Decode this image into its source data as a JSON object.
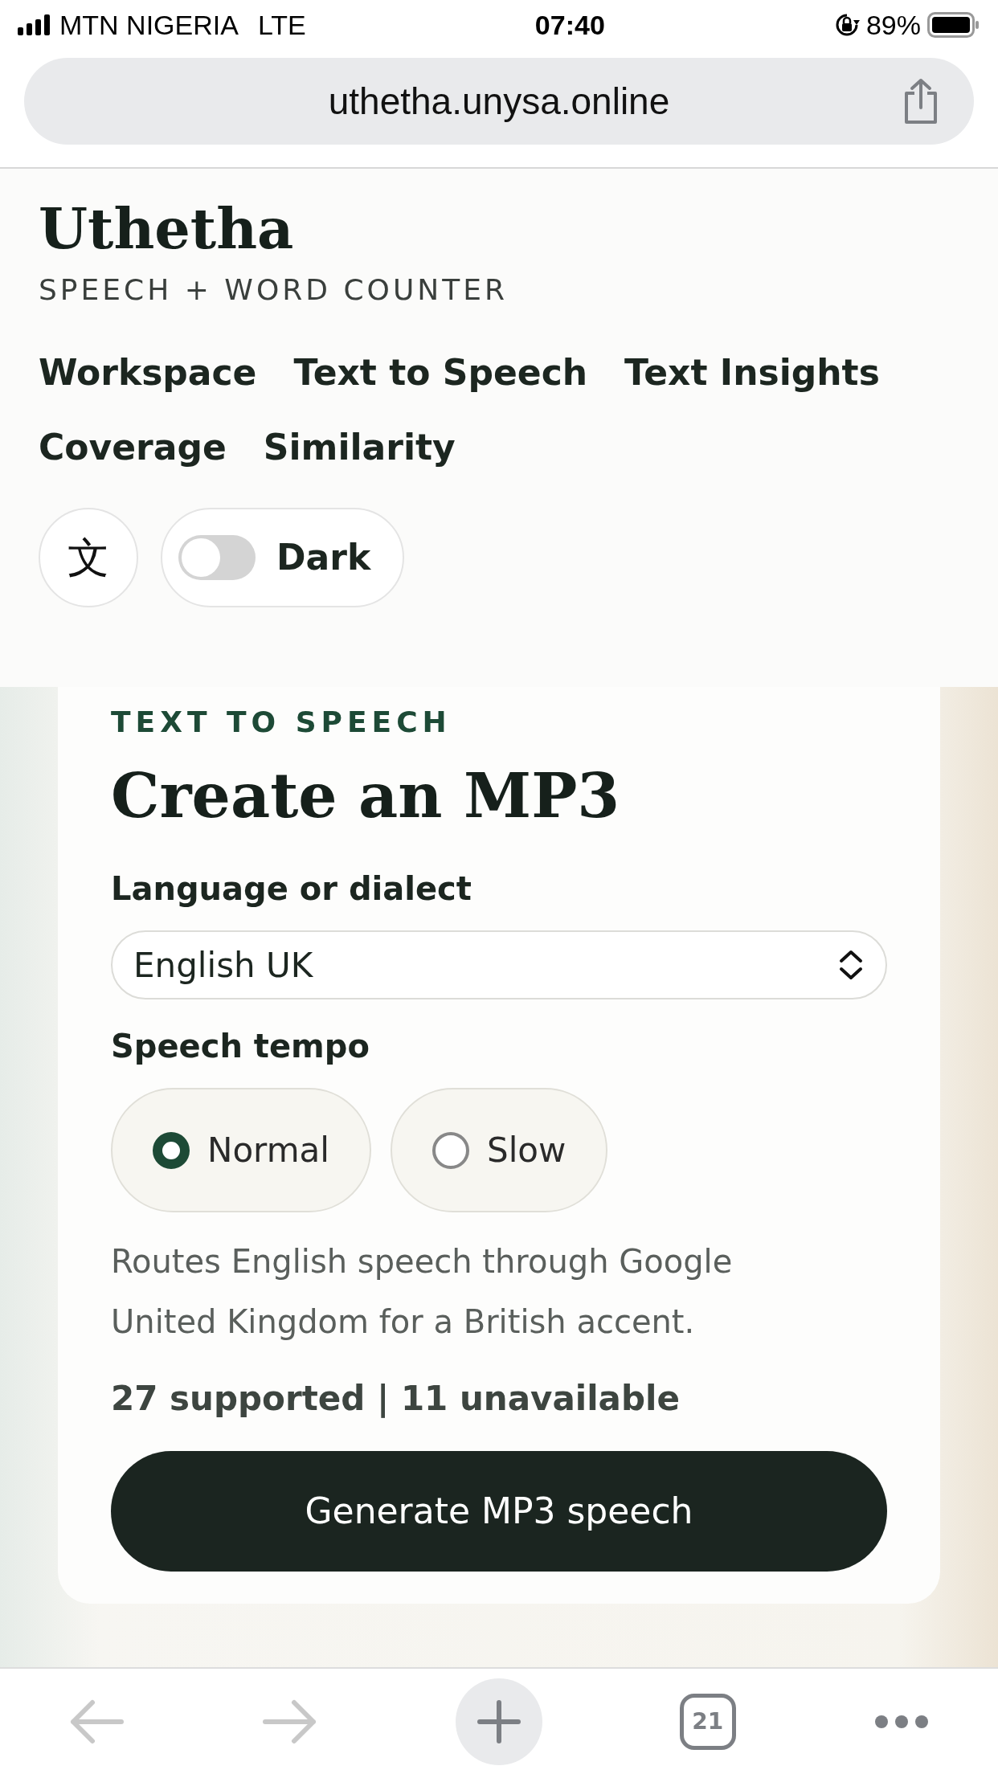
{
  "status_bar": {
    "carrier": "MTN NIGERIA",
    "network": "LTE",
    "time": "07:40",
    "battery": "89%"
  },
  "address_bar": {
    "url": "uthetha.unysa.online"
  },
  "header": {
    "title": "Uthetha",
    "subtitle": "SPEECH + WORD COUNTER",
    "nav": [
      "Workspace",
      "Text to Speech",
      "Text Insights",
      "Coverage",
      "Similarity"
    ],
    "language_button": "文",
    "dark_toggle": {
      "label": "Dark",
      "on": false
    }
  },
  "tts_card": {
    "eyebrow": "TEXT TO SPEECH",
    "heading": "Create an MP3",
    "language_label": "Language or dialect",
    "language_value": "English UK",
    "tempo_label": "Speech tempo",
    "tempo_options": [
      {
        "label": "Normal",
        "selected": true
      },
      {
        "label": "Slow",
        "selected": false
      }
    ],
    "help": "Routes English speech through Google United Kingdom for a British accent.",
    "counts": "27 supported | 11 unavailable",
    "generate_button": "Generate MP3 speech"
  },
  "toolbar": {
    "tabs_count": "21"
  }
}
